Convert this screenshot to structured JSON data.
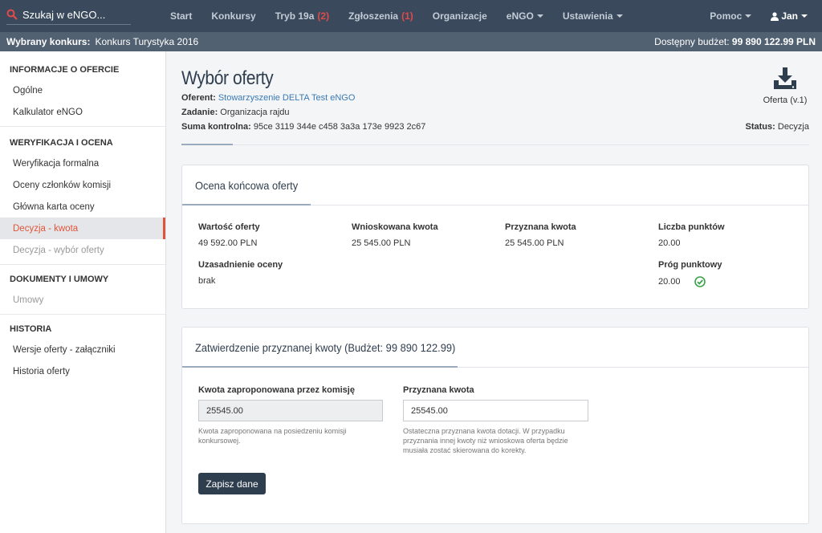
{
  "topbar": {
    "search_placeholder": "Szukaj w eNGO...",
    "nav": [
      {
        "label": "Start"
      },
      {
        "label": "Konkursy"
      },
      {
        "label": "Tryb 19a",
        "count": "(2)"
      },
      {
        "label": "Zgłoszenia",
        "count": "(1)"
      },
      {
        "label": "Organizacje"
      },
      {
        "label": "eNGO"
      },
      {
        "label": "Ustawienia"
      }
    ],
    "help_label": "Pomoc",
    "user_label": "Jan"
  },
  "context": {
    "contest_label": "Wybrany konkurs:",
    "contest_value": "Konkurs Turystyka 2016",
    "budget_label": "Dostępny budżet:",
    "budget_value": "99 890 122.99 PLN"
  },
  "sidebar": {
    "sections": [
      {
        "title": "INFORMACJE O OFERCIE",
        "items": [
          "Ogólne",
          "Kalkulator eNGO"
        ]
      },
      {
        "title": "WERYFIKACJA I OCENA",
        "items": [
          "Weryfikacja formalna",
          "Oceny członków komisji",
          "Główna karta oceny",
          "Decyzja - kwota",
          "Decyzja - wybór oferty"
        ]
      },
      {
        "title": "DOKUMENTY I UMOWY",
        "items": [
          "Umowy"
        ]
      },
      {
        "title": "HISTORIA",
        "items": [
          "Wersje oferty - załączniki",
          "Historia oferty"
        ]
      }
    ]
  },
  "header": {
    "title": "Wybór oferty",
    "oferent_label": "Oferent:",
    "oferent_value": "Stowarzyszenie DELTA Test eNGO",
    "zadanie_label": "Zadanie:",
    "zadanie_value": "Organizacja rajdu",
    "checksum_label": "Suma kontrolna:",
    "checksum_value": "95ce 3119 344e c458 3a3a 173e 9923 2c67",
    "download_label": "Oferta (v.1)",
    "status_label": "Status:",
    "status_value": "Decyzja"
  },
  "evaluation": {
    "title": "Ocena końcowa oferty",
    "offer_value_label": "Wartość oferty",
    "offer_value": "49 592.00 PLN",
    "requested_label": "Wnioskowana kwota",
    "requested_value": "25 545.00 PLN",
    "granted_label": "Przyznana kwota",
    "granted_value": "25 545.00 PLN",
    "points_label": "Liczba punktów",
    "points_value": "20.00",
    "justification_label": "Uzasadnienie oceny",
    "justification_value": "brak",
    "threshold_label": "Próg punktowy",
    "threshold_value": "20.00"
  },
  "approval": {
    "title": "Zatwierdzenie przyznanej kwoty (Budżet: 99 890 122.99)",
    "proposed_label": "Kwota zaproponowana przez komisję",
    "proposed_value": "25545.00",
    "proposed_help": "Kwota zaproponowana na posiedzeniu komisji konkursowej.",
    "granted_label": "Przyznana kwota",
    "granted_value": "25545.00",
    "granted_help": "Ostateczna przyznana kwota dotacji. W przypadku przyznania innej kwoty niż wnioskowa oferta będzie musiała zostać skierowana do korekty.",
    "save_label": "Zapisz dane"
  }
}
